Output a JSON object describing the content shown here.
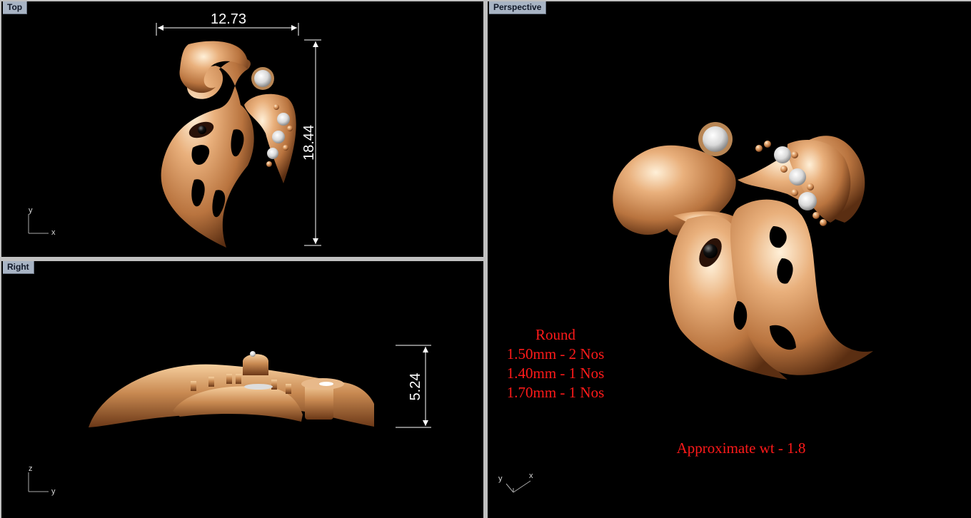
{
  "viewports": {
    "top": {
      "label": "Top",
      "dimension_width": "12.73",
      "dimension_height": "18.44",
      "axis_y": "y",
      "axis_x": "x"
    },
    "right": {
      "label": "Right",
      "dimension_thickness": "5.24",
      "axis_z": "z",
      "axis_y": "y"
    },
    "perspective": {
      "label": "Perspective",
      "axis_y": "y",
      "axis_x": "x",
      "stone_heading": "Round",
      "stone_lines": [
        "1.50mm - 2 Nos",
        "1.40mm - 1 Nos",
        "1.70mm - 1 Nos"
      ],
      "weight_note": "Approximate wt - 1.8"
    }
  },
  "colors": {
    "gold": "#d89a63",
    "annotation_red": "#ff1a1a",
    "viewport_bg": "#000000",
    "label_bg": "#a8b4c4"
  }
}
